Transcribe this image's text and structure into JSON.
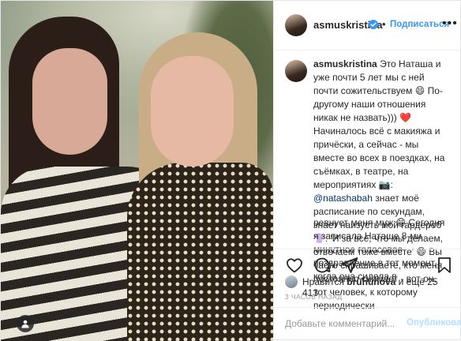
{
  "post": {
    "username": "asmuskristina",
    "dot": "•",
    "follow_label": "Подписаться",
    "more_label": "•••"
  },
  "caption": {
    "username": "asmuskristina",
    "text_1": "Это Наташа и уже почти 5 лет мы с ней почти сожительствуем 😄 По-другому наши отношения никак не назвать))) ❤️ Начиналось всё с макияжа и причёски, а сейчас - мы вместе во всех в поездках, на съёмках, в театре, на мероприятиях 📷:",
    "mention": "@natashabah",
    "text_2": "знает моё расписание по секундам, знает наизусть мой гардероб 👚: 'И за все, что мы делаем, отвечаем тоже вместе' 😄 Вы часто спрашиваете, кто меня постоянно снимает - вот он, тот человек, к которому периодически"
  },
  "comment": {
    "text": "ревнует меня муж 😁 Сегодня я записала Наташе 8-ми минутное голосовое поздравление в тот момент, когда она сидела в"
  },
  "likes": {
    "prefix": "Нравится",
    "user": "bruhunova",
    "suffix": "и ещё 25 413"
  },
  "timestamp": "3 ЧАСОВ НАЗАД",
  "comment_box": {
    "placeholder": "Добавьте комментарий...",
    "publish_label": "Опубликовать"
  },
  "icons": {
    "verified": "verified-badge-icon",
    "like": "heart-icon",
    "comment": "speech-bubble-icon",
    "share": "share-icon",
    "save": "bookmark-icon",
    "tag": "person-tag-icon"
  },
  "colors": {
    "link_blue": "#3897f0",
    "verified_blue": "#3897f0",
    "publish_disabled": "#b2dffc",
    "muted": "#999999"
  }
}
